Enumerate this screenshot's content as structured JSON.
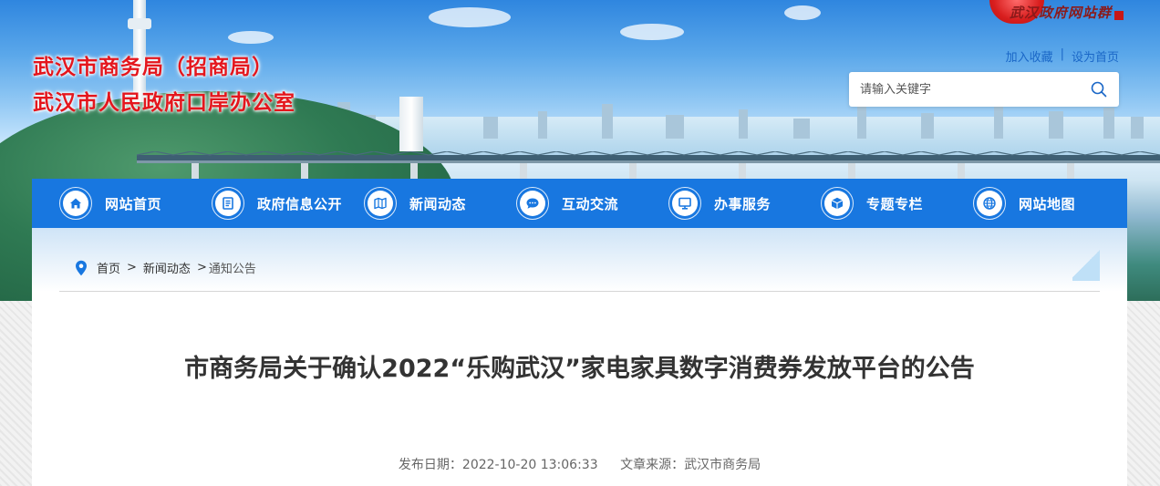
{
  "header": {
    "site_title_1": "武汉市商务局（招商局）",
    "site_title_2": "武汉市人民政府口岸办公室",
    "gov_logo_text": "武汉政府网站群",
    "quick_links": [
      "加入收藏",
      "设为首页"
    ],
    "quick_links_separator": "|"
  },
  "search": {
    "placeholder": "请输入关键字",
    "icon": "search-icon"
  },
  "nav": {
    "items": [
      {
        "label": "网站首页",
        "icon": "home-icon"
      },
      {
        "label": "政府信息公开",
        "icon": "document-icon"
      },
      {
        "label": "新闻动态",
        "icon": "map-icon"
      },
      {
        "label": "互动交流",
        "icon": "chat-icon"
      },
      {
        "label": "办事服务",
        "icon": "monitor-icon"
      },
      {
        "label": "专题专栏",
        "icon": "box-icon"
      },
      {
        "label": "网站地图",
        "icon": "globe-icon"
      }
    ]
  },
  "breadcrumb": {
    "items": [
      "首页",
      "新闻动态",
      "通知公告"
    ],
    "separator": ">",
    "icon": "location-pin-icon"
  },
  "article": {
    "title": "市商务局关于确认2022“乐购武汉”家电家具数字消费券发放平台的公告",
    "publish_date_label": "发布日期：",
    "publish_date": "2022-10-20 13:06:33",
    "source_label": "文章来源：",
    "source": "武汉市商务局"
  },
  "colors": {
    "nav_blue": "#1877e0",
    "title_red": "#e4161d",
    "link_blue": "#1a67c7"
  }
}
